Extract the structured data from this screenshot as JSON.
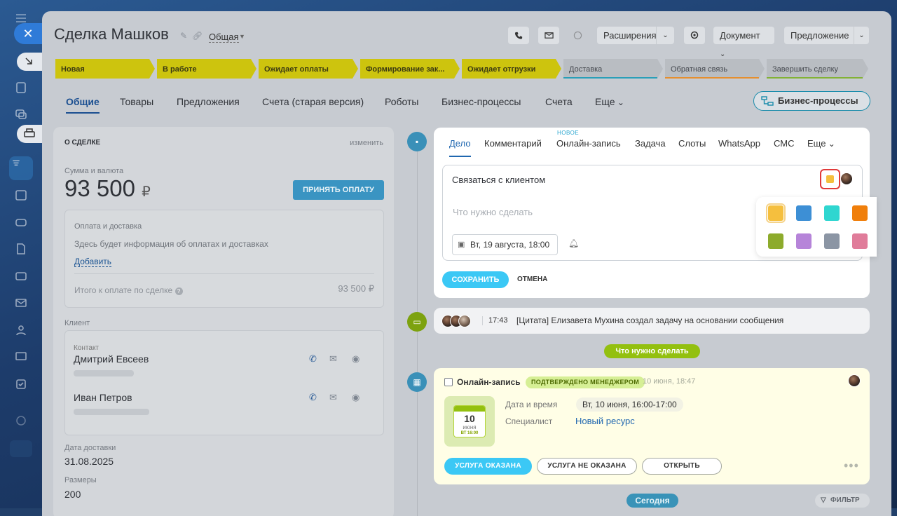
{
  "deal": {
    "title": "Сделка Машков",
    "category": "Общая"
  },
  "toolbar": {
    "extensions": "Расширения",
    "document": "Документ",
    "proposal": "Предложение"
  },
  "stages": [
    {
      "label": "Новая",
      "active": true
    },
    {
      "label": "В работе",
      "active": true
    },
    {
      "label": "Ожидает оплаты",
      "active": true
    },
    {
      "label": "Формирование зак...",
      "active": true
    },
    {
      "label": "Ожидает отгрузки",
      "active": true
    },
    {
      "label": "Доставка",
      "active": false,
      "color": "#2a9fb8"
    },
    {
      "label": "Обратная связь",
      "active": false,
      "color": "#e58f2f"
    },
    {
      "label": "Завершить сделку",
      "active": false,
      "color": "#83b236"
    }
  ],
  "tabs": [
    "Общие",
    "Товары",
    "Предложения",
    "Счета (старая версия)",
    "Роботы",
    "Бизнес-процессы",
    "Счета",
    "Еще"
  ],
  "bp_button": "Бизнес-процессы",
  "about": {
    "header": "О СДЕЛКЕ",
    "edit": "изменить",
    "sum_label": "Сумма и валюта",
    "sum": "93 500",
    "currency": "₽",
    "pay_button": "ПРИНЯТЬ ОПЛАТУ",
    "payment_title": "Оплата и доставка",
    "payment_text": "Здесь будет информация об оплатах и доставках",
    "add": "Добавить",
    "total_label": "Итого к оплате по сделке",
    "total": "93 500 ₽",
    "client_label": "Клиент",
    "contact_label": "Контакт",
    "contact1": "Дмитрий Евсеев",
    "contact2": "Иван Петров",
    "delivery_label": "Дата доставки",
    "delivery": "31.08.2025",
    "size_label": "Размеры",
    "size": "200"
  },
  "editor": {
    "tabs": [
      "Дело",
      "Комментарий",
      "Онлайн-запись",
      "Задача",
      "Слоты",
      "WhatsApp",
      "СМС",
      "Еще"
    ],
    "new_tag": "НОВОЕ",
    "title_value": "Связаться с клиентом",
    "placeholder": "Что нужно сделать",
    "date": "Вт, 19 августа, 18:00",
    "save": "СОХРАНИТЬ",
    "cancel": "ОТМЕНА"
  },
  "palette": [
    "#f5bf3e",
    "#3d8fd5",
    "#2fd6d0",
    "#f07f0b",
    "#8dab2c",
    "#b684d9",
    "#8b95a4",
    "#e07c9a"
  ],
  "activity": {
    "time": "17:43",
    "text": "[Цитата] Елизавета Мухина создал задачу на основании сообщения"
  },
  "todo_pill": "Что нужно сделать",
  "booking": {
    "title": "Онлайн-запись",
    "badge": "ПОДТВЕРЖДЕНО МЕНЕДЖЕРОМ",
    "date": "10 июня, 18:47",
    "cal_day": "10",
    "cal_month": "июня",
    "cal_time": "ВТ 16:00",
    "dt_label": "Дата и время",
    "dt_value": "Вт, 10 июня, 16:00-17:00",
    "spec_label": "Специалист",
    "spec_value": "Новый ресурс",
    "btn_done": "УСЛУГА ОКАЗАНА",
    "btn_notdone": "УСЛУГА НЕ ОКАЗАНА",
    "btn_open": "ОТКРЫТЬ"
  },
  "today": "Сегодня",
  "filter": "ФИЛЬТР"
}
